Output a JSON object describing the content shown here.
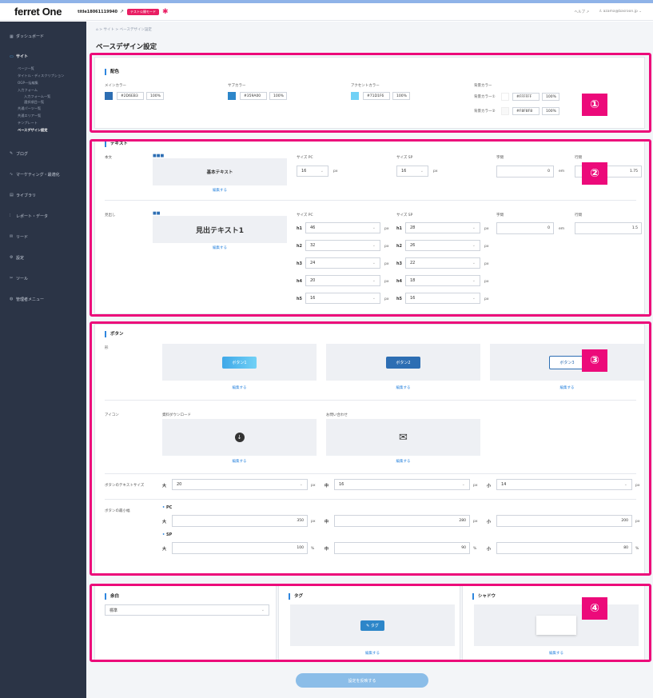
{
  "topbar": {
    "logo": "ferret One",
    "site_title": "title18061119940",
    "test_badge": "テスト公開モード",
    "help": "ヘルプ",
    "user": "azama@basroon.jp"
  },
  "sidebar": {
    "items": [
      {
        "icon": "dashboard-icon",
        "glyph": "▦",
        "label": "ダッシュボード"
      },
      {
        "icon": "site-icon",
        "glyph": "▭",
        "label": "サイト"
      },
      {
        "icon": "blog-icon",
        "glyph": "✎",
        "label": "ブログ"
      },
      {
        "icon": "marketing-icon",
        "glyph": "∿",
        "label": "マーケティング・最適化"
      },
      {
        "icon": "library-icon",
        "glyph": "▤",
        "label": "ライブラリ"
      },
      {
        "icon": "report-icon",
        "glyph": "⫶",
        "label": "レポート・データ"
      },
      {
        "icon": "lead-icon",
        "glyph": "✉",
        "label": "リード"
      },
      {
        "icon": "settings-icon",
        "glyph": "⚙",
        "label": "設定"
      },
      {
        "icon": "tool-icon",
        "glyph": "✂",
        "label": "ツール"
      },
      {
        "icon": "admin-icon",
        "glyph": "◍",
        "label": "管理者メニュー"
      }
    ],
    "site_sub": [
      "ページ一覧",
      "タイトル・ディスクリプション",
      "OGP一括編集",
      "入力フォーム"
    ],
    "form_sub": [
      "入力フォーム一覧",
      "選択項目一覧"
    ],
    "site_sub2": [
      "共通パーツ一覧",
      "共通エリア一覧",
      "テンプレート",
      "ベースデザイン設定"
    ]
  },
  "breadcrumb": "⌂ > サイト > ベースデザイン設定",
  "page_title": "ベースデザイン設定",
  "colors_section": {
    "title": "配色",
    "main": {
      "label": "メインカラー",
      "hex": "#2D6EB3",
      "opacity": "100%",
      "swatch": "#2d6eb3"
    },
    "sub": {
      "label": "サブカラー",
      "hex": "#359A00",
      "opacity": "100%",
      "swatch": "#2d86c9"
    },
    "accent": {
      "label": "アクセントカラー",
      "hex": "#71D1F6",
      "opacity": "100%",
      "swatch": "#71d1f6"
    },
    "bg": {
      "label": "背景カラー",
      "bg1_label": "背景カラー①",
      "bg1_hex": "#FFFFFF",
      "bg1_opacity": "100%",
      "bg2_label": "背景カラー②",
      "bg2_hex": "#F8F8F8",
      "bg2_opacity": "100%"
    }
  },
  "text_section": {
    "title": "テキスト",
    "body_label": "本文",
    "body_preview": "基本テキスト",
    "heading_label": "見出し",
    "heading_preview": "見出テキスト1",
    "edit": "編集する",
    "size_pc": "サイズ PC",
    "size_sp": "サイズ SP",
    "spacing": "字間",
    "line_height": "行間",
    "body_pc": "16",
    "body_sp": "16",
    "body_spacing": "0",
    "body_lh": "1.75",
    "px": "px",
    "em": "em",
    "heading_spacing": "0",
    "heading_lh": "1.5",
    "headings": [
      {
        "h": "h1",
        "pc": "46",
        "sp": "28"
      },
      {
        "h": "h2",
        "pc": "32",
        "sp": "26"
      },
      {
        "h": "h3",
        "pc": "24",
        "sp": "22"
      },
      {
        "h": "h4",
        "pc": "20",
        "sp": "18"
      },
      {
        "h": "h5",
        "pc": "16",
        "sp": "16"
      }
    ]
  },
  "button_section": {
    "title": "ボタン",
    "shape_label": "形",
    "btn1": "ボタン1",
    "btn2": "ボタン2",
    "btn3": "ボタン3",
    "edit": "編集する",
    "icon_label": "アイコン",
    "icon1_label": "資料ダウンロード",
    "icon2_label": "お問い合わせ",
    "text_size_label": "ボタンのテキストサイズ",
    "large": "大",
    "medium": "中",
    "small": "小",
    "ts_large": "20",
    "ts_medium": "16",
    "ts_small": "14",
    "min_width_label": "ボタンの最小幅",
    "pc": "PC",
    "sp": "SP",
    "pc_large": "350",
    "pc_medium": "280",
    "pc_small": "200",
    "sp_large": "100",
    "sp_medium": "90",
    "sp_small": "80",
    "px": "px",
    "pct": "%"
  },
  "misc_section": {
    "margin_title": "余白",
    "margin_value": "標準",
    "tag_title": "タグ",
    "tag_preview": "タグ",
    "shadow_title": "シャドウ",
    "edit": "編集する"
  },
  "annotations": [
    "①",
    "②",
    "③",
    "④"
  ],
  "submit": "設定を反映する"
}
